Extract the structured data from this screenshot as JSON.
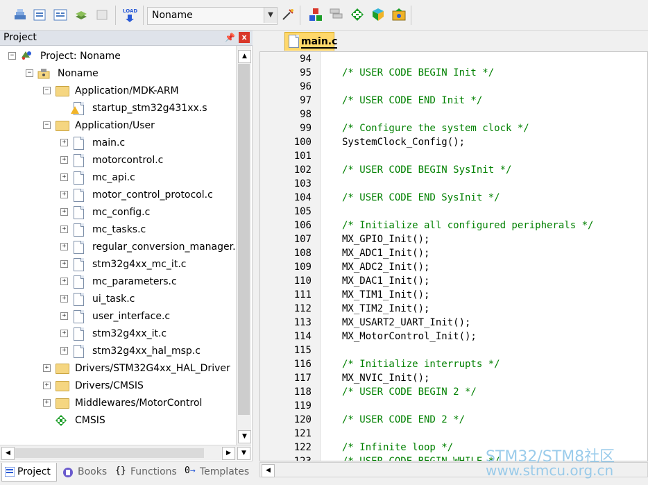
{
  "toolbar": {
    "target_name": "Noname",
    "load_label": "LOAD",
    "colors": {
      "accent_red": "#d9382b",
      "green": "#1e9e2a",
      "blue": "#2a5bd7"
    }
  },
  "panel": {
    "title": "Project",
    "pin": "↕",
    "close": "x"
  },
  "tree": {
    "items": [
      {
        "label": "Project: Noname",
        "icon": "project-icon"
      },
      {
        "label": "Noname",
        "icon": "target-icon"
      },
      {
        "label": "Application/MDK-ARM",
        "icon": "folder-icon"
      },
      {
        "label": "startup_stm32g431xx.s",
        "icon": "warning-file-icon"
      },
      {
        "label": "Application/User",
        "icon": "folder-icon"
      },
      {
        "label": "main.c",
        "icon": "file-icon"
      },
      {
        "label": "motorcontrol.c",
        "icon": "file-icon"
      },
      {
        "label": "mc_api.c",
        "icon": "file-icon"
      },
      {
        "label": "motor_control_protocol.c",
        "icon": "file-icon"
      },
      {
        "label": "mc_config.c",
        "icon": "file-icon"
      },
      {
        "label": "mc_tasks.c",
        "icon": "file-icon"
      },
      {
        "label": "regular_conversion_manager.c",
        "icon": "file-icon"
      },
      {
        "label": "stm32g4xx_mc_it.c",
        "icon": "file-icon"
      },
      {
        "label": "mc_parameters.c",
        "icon": "file-icon"
      },
      {
        "label": "ui_task.c",
        "icon": "file-icon"
      },
      {
        "label": "user_interface.c",
        "icon": "file-icon"
      },
      {
        "label": "stm32g4xx_it.c",
        "icon": "file-icon"
      },
      {
        "label": "stm32g4xx_hal_msp.c",
        "icon": "file-icon"
      },
      {
        "label": "Drivers/STM32G4xx_HAL_Driver",
        "icon": "folder-icon"
      },
      {
        "label": "Drivers/CMSIS",
        "icon": "folder-icon"
      },
      {
        "label": "Middlewares/MotorControl",
        "icon": "folder-icon"
      },
      {
        "label": "CMSIS",
        "icon": "cmsis-icon"
      }
    ]
  },
  "tabs": [
    {
      "label": "Project"
    },
    {
      "label": "Books"
    },
    {
      "label": "Functions"
    },
    {
      "label": "Templates"
    }
  ],
  "editor": {
    "file_tab": "main.c",
    "lines": [
      {
        "n": "94",
        "code": "",
        "type": "code"
      },
      {
        "n": "95",
        "code": "/* USER CODE BEGIN Init */",
        "type": "comment"
      },
      {
        "n": "96",
        "code": "",
        "type": "code"
      },
      {
        "n": "97",
        "code": "/* USER CODE END Init */",
        "type": "comment"
      },
      {
        "n": "98",
        "code": "",
        "type": "code"
      },
      {
        "n": "99",
        "code": "/* Configure the system clock */",
        "type": "comment"
      },
      {
        "n": "100",
        "code": "SystemClock_Config();",
        "type": "code"
      },
      {
        "n": "101",
        "code": "",
        "type": "code"
      },
      {
        "n": "102",
        "code": "/* USER CODE BEGIN SysInit */",
        "type": "comment"
      },
      {
        "n": "103",
        "code": "",
        "type": "code"
      },
      {
        "n": "104",
        "code": "/* USER CODE END SysInit */",
        "type": "comment"
      },
      {
        "n": "105",
        "code": "",
        "type": "code"
      },
      {
        "n": "106",
        "code": "/* Initialize all configured peripherals */",
        "type": "comment"
      },
      {
        "n": "107",
        "code": "MX_GPIO_Init();",
        "type": "code"
      },
      {
        "n": "108",
        "code": "MX_ADC1_Init();",
        "type": "code"
      },
      {
        "n": "109",
        "code": "MX_ADC2_Init();",
        "type": "code"
      },
      {
        "n": "110",
        "code": "MX_DAC1_Init();",
        "type": "code"
      },
      {
        "n": "111",
        "code": "MX_TIM1_Init();",
        "type": "code"
      },
      {
        "n": "112",
        "code": "MX_TIM2_Init();",
        "type": "code"
      },
      {
        "n": "113",
        "code": "MX_USART2_UART_Init();",
        "type": "code"
      },
      {
        "n": "114",
        "code": "MX_MotorControl_Init();",
        "type": "code"
      },
      {
        "n": "115",
        "code": "",
        "type": "code"
      },
      {
        "n": "116",
        "code": "/* Initialize interrupts */",
        "type": "comment"
      },
      {
        "n": "117",
        "code": "MX_NVIC_Init();",
        "type": "code"
      },
      {
        "n": "118",
        "code": "/* USER CODE BEGIN 2 */",
        "type": "comment"
      },
      {
        "n": "119",
        "code": "",
        "type": "code"
      },
      {
        "n": "120",
        "code": "/* USER CODE END 2 */",
        "type": "comment"
      },
      {
        "n": "121",
        "code": "",
        "type": "code"
      },
      {
        "n": "122",
        "code": "/* Infinite loop */",
        "type": "comment"
      },
      {
        "n": "123",
        "code": "/* USER CODE BEGIN WHILE */",
        "type": "comment"
      }
    ]
  },
  "watermark": {
    "line1": "STM32/STM8社区",
    "line2": "www.stmcu.org.cn"
  }
}
